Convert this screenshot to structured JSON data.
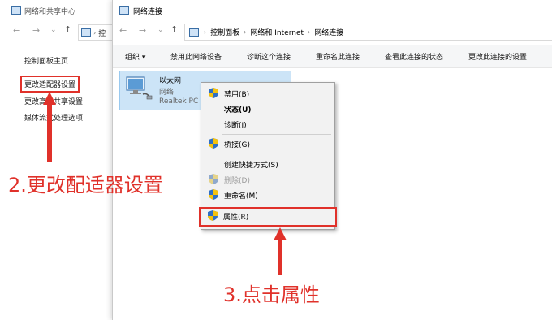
{
  "back_window": {
    "title": "网络和共享中心",
    "address_partial": "控",
    "side_links": [
      "控制面板主页",
      "更改适配器设置",
      "更改高级共享设置",
      "媒体流式处理选项"
    ]
  },
  "main_window": {
    "title": "网络连接",
    "breadcrumb": [
      "控制面板",
      "网络和 Internet",
      "网络连接"
    ],
    "commands": [
      "组织 ▾",
      "禁用此网络设备",
      "诊断这个连接",
      "重命名此连接",
      "查看此连接的状态",
      "更改此连接的设置"
    ]
  },
  "adapter": {
    "name": "以太网",
    "network": "网络",
    "device": "Realtek PC"
  },
  "context_menu": {
    "items": [
      {
        "label": "禁用(B)",
        "shield": true
      },
      {
        "label": "状态(U)",
        "bold": true
      },
      {
        "label": "诊断(I)"
      },
      {
        "label": "桥接(G)",
        "shield": true
      },
      {
        "label": "创建快捷方式(S)"
      },
      {
        "label": "删除(D)",
        "shield": true,
        "disabled": true
      },
      {
        "label": "重命名(M)",
        "shield": true
      },
      {
        "label": "属性(R)",
        "shield": true,
        "highlighted": true
      }
    ]
  },
  "annotations": {
    "step2": "2.更改配适器设置",
    "step3": "3.点击属性"
  },
  "colors": {
    "annotation_red": "#e0312a",
    "selection_blue": "#cce4f7"
  }
}
